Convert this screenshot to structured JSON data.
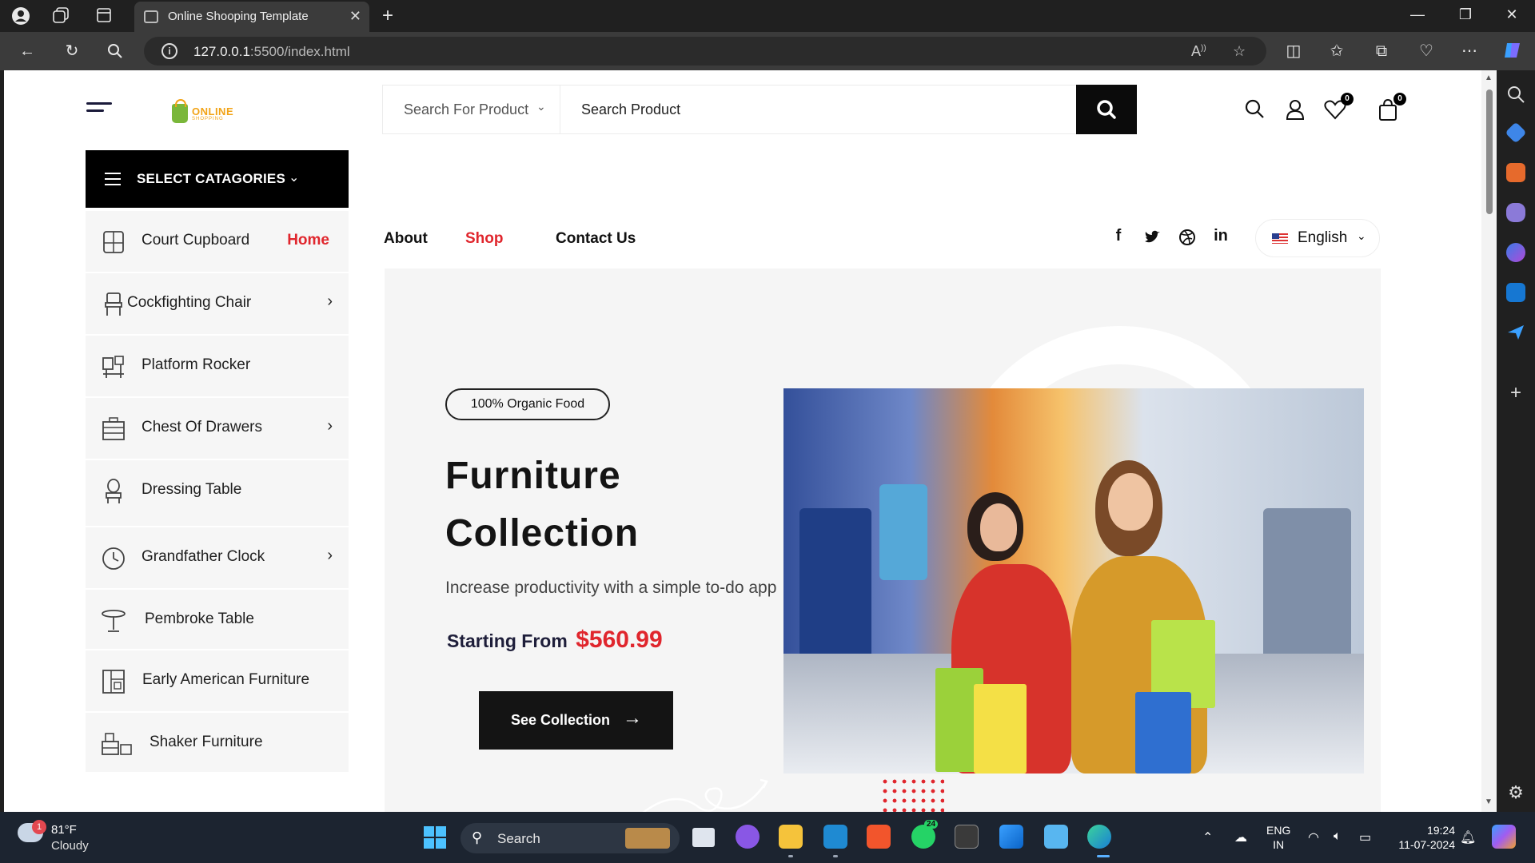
{
  "browser": {
    "tab_title": "Online Shooping Template",
    "url_host": "127.0.0.1",
    "url_path": ":5500/index.html"
  },
  "header": {
    "logo_text": "ONLINE",
    "logo_sub": "SHOPPING",
    "search_category_label": "Search For Product",
    "search_placeholder": "Search Product",
    "wishlist_count": "0",
    "cart_count": "0"
  },
  "categories": {
    "header_label": "SELECT CATAGORIES",
    "items": [
      {
        "label": "Court Cupboard",
        "icon": "cupboard-icon",
        "extra": "Home"
      },
      {
        "label": "Cockfighting Chair",
        "icon": "chair-icon",
        "has_submenu": true
      },
      {
        "label": "Platform Rocker",
        "icon": "rocker-icon"
      },
      {
        "label": "Chest Of Drawers",
        "icon": "drawers-icon",
        "has_submenu": true
      },
      {
        "label": "Dressing Table",
        "icon": "dressing-table-icon"
      },
      {
        "label": "Grandfather Clock",
        "icon": "clock-icon",
        "has_submenu": true
      },
      {
        "label": "Pembroke Table",
        "icon": "table-icon"
      },
      {
        "label": "Early American Furniture",
        "icon": "cabinet-icon"
      },
      {
        "label": "Shaker Furniture",
        "icon": "furniture-icon"
      }
    ]
  },
  "nav": {
    "about": "About",
    "shop": "Shop",
    "contact": "Contact Us",
    "language": "English"
  },
  "hero": {
    "badge": "100% Organic Food",
    "title_line1": "Furniture",
    "title_line2": "Collection",
    "subtitle": "Increase productivity with a simple to-do app",
    "price_label": "Starting From",
    "price": "$560.99",
    "cta": "See Collection"
  },
  "taskbar": {
    "temp": "81°F",
    "condition": "Cloudy",
    "weather_badge": "1",
    "search_label": "Search",
    "whatsapp_badge": "24",
    "lang_line1": "ENG",
    "lang_line2": "IN",
    "time": "19:24",
    "date": "11-07-2024"
  },
  "colors": {
    "accent_red": "#e0262d",
    "black": "#0b0b0b",
    "hero_bg": "#f5f5f5",
    "category_bg": "#f6f6f6"
  }
}
